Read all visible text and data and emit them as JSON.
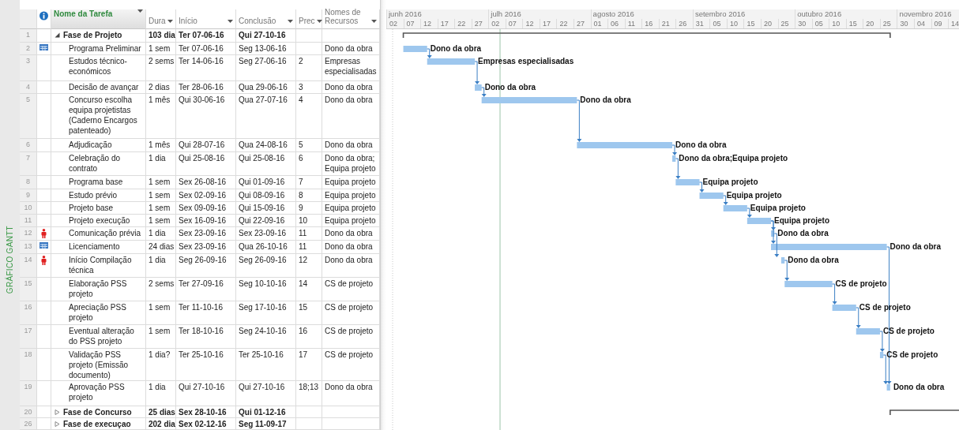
{
  "view_label": "GRÁFICO GANTT",
  "columns": [
    {
      "kind": "indicator",
      "selected": false
    },
    {
      "kind": "text",
      "label": "Nome da Tarefa",
      "selected": true
    },
    {
      "kind": "text",
      "label": "Dura",
      "selected": false
    },
    {
      "kind": "text",
      "label": "Início",
      "selected": false
    },
    {
      "kind": "text",
      "label": "Conclusão",
      "selected": false
    },
    {
      "kind": "text",
      "label": "Prec",
      "selected": false
    },
    {
      "kind": "text",
      "label": "Nomes de Recursos",
      "selected": false
    }
  ],
  "timeline": {
    "months": [
      {
        "label": "junh 2016",
        "days": [
          "02",
          "07",
          "12",
          "17",
          "22",
          "27"
        ]
      },
      {
        "label": "julh 2016",
        "days": [
          "02",
          "07",
          "12",
          "17",
          "22",
          "27"
        ]
      },
      {
        "label": "agosto 2016",
        "days": [
          "01",
          "06",
          "11",
          "16",
          "21",
          "26"
        ]
      },
      {
        "label": "setembro 2016",
        "days": [
          "31",
          "05",
          "10",
          "15",
          "20",
          "25"
        ]
      },
      {
        "label": "outubro 2016",
        "days": [
          "30",
          "05",
          "10",
          "15",
          "20",
          "25"
        ]
      },
      {
        "label": "novembro 2016",
        "days": [
          "30",
          "04",
          "09",
          "14"
        ]
      }
    ]
  },
  "tasks": [
    {
      "id": "1",
      "kind": "summary",
      "expanded": true,
      "name": "Fase de Projeto",
      "duration": "103 dia",
      "start": "Ter 07-06-16",
      "finish": "Qui 27-10-16",
      "children": [
        {
          "id": "2",
          "kind": "task",
          "indicator": {
            "kind": "calendar"
          },
          "name": "Programa Preliminar",
          "duration": "1 sem",
          "start": "Ter 07-06-16",
          "finish": "Seg 13-06-16",
          "resources": "Dono da obra",
          "bar_label": "Dono da obra"
        },
        {
          "id": "3",
          "kind": "task",
          "name": "Estudos técnico-económicos",
          "duration": "2 sems",
          "start": "Ter 14-06-16",
          "finish": "Seg 27-06-16",
          "predecessors": "2",
          "resources": "Empresas especialisadas",
          "bar_label": "Empresas especialisadas"
        },
        {
          "id": "4",
          "kind": "task",
          "name": "Decisão de avançar",
          "duration": "2 dias",
          "start": "Ter 28-06-16",
          "finish": "Qua 29-06-16",
          "predecessors": "3",
          "resources": "Dono da obra",
          "bar_label": "Dono da obra"
        },
        {
          "id": "5",
          "kind": "task",
          "name": "Concurso escolha equipa projetistas (Caderno Encargos patenteado)",
          "duration": "1 mês",
          "start": "Qui 30-06-16",
          "finish": "Qua 27-07-16",
          "predecessors": "4",
          "resources": "Dono da obra",
          "bar_label": "Dono da obra"
        },
        {
          "id": "6",
          "kind": "task",
          "name": "Adjudicação",
          "duration": "1 mês",
          "start": "Qui 28-07-16",
          "finish": "Qua 24-08-16",
          "predecessors": "5",
          "resources": "Dono da obra",
          "bar_label": "Dono da obra"
        },
        {
          "id": "7",
          "kind": "task",
          "name": "Celebração do contrato",
          "duration": "1 dia",
          "start": "Qui 25-08-16",
          "finish": "Qui 25-08-16",
          "predecessors": "6",
          "resources": "Dono da obra; Equipa projeto",
          "bar_label": "Dono da obra;Equipa projeto"
        },
        {
          "id": "8",
          "kind": "task",
          "name": "Programa base",
          "duration": "1 sem",
          "start": "Sex 26-08-16",
          "finish": "Qui 01-09-16",
          "predecessors": "7",
          "resources": "Equipa projeto",
          "bar_label": "Equipa projeto"
        },
        {
          "id": "9",
          "kind": "task",
          "name": "Estudo prévio",
          "duration": "1 sem",
          "start": "Sex 02-09-16",
          "finish": "Qui 08-09-16",
          "predecessors": "8",
          "resources": "Equipa projeto",
          "bar_label": "Equipa projeto"
        },
        {
          "id": "10",
          "kind": "task",
          "name": "Projeto base",
          "duration": "1 sem",
          "start": "Sex 09-09-16",
          "finish": "Qui 15-09-16",
          "predecessors": "9",
          "resources": "Equipa projeto",
          "bar_label": "Equipa projeto"
        },
        {
          "id": "11",
          "kind": "task",
          "name": "Projeto execução",
          "duration": "1 sem",
          "start": "Sex 16-09-16",
          "finish": "Qui 22-09-16",
          "predecessors": "10",
          "resources": "Equipa projeto",
          "bar_label": "Equipa projeto"
        },
        {
          "id": "12",
          "kind": "task",
          "indicator": {
            "kind": "person"
          },
          "name": "Comunicação prévia",
          "duration": "1 dia",
          "start": "Sex 23-09-16",
          "finish": "Sex 23-09-16",
          "predecessors": "11",
          "resources": "Dono da obra",
          "bar_label": "Dono da obra"
        },
        {
          "id": "13",
          "kind": "task",
          "indicator": {
            "kind": "calendar"
          },
          "name": "Licenciamento",
          "duration": "24 dias",
          "start": "Sex 23-09-16",
          "finish": "Qua 26-10-16",
          "predecessors": "11",
          "resources": "Dono da obra",
          "bar_label": "Dono da obra"
        },
        {
          "id": "14",
          "kind": "task",
          "indicator": {
            "kind": "person"
          },
          "name": "Início Compilação técnica",
          "duration": "1 dia",
          "start": "Seg 26-09-16",
          "finish": "Seg 26-09-16",
          "predecessors": "12",
          "resources": "Dono da obra",
          "bar_label": "Dono da obra"
        },
        {
          "id": "15",
          "kind": "task",
          "name": "Elaboração PSS projeto",
          "duration": "2 sems",
          "start": "Ter 27-09-16",
          "finish": "Seg 10-10-16",
          "predecessors": "14",
          "resources": "CS de projeto",
          "bar_label": "CS de projeto"
        },
        {
          "id": "16",
          "kind": "task",
          "name": "Apreciação PSS projeto",
          "duration": "1 sem",
          "start": "Ter 11-10-16",
          "finish": "Seg 17-10-16",
          "predecessors": "15",
          "resources": "CS de projeto",
          "bar_label": "CS de projeto"
        },
        {
          "id": "17",
          "kind": "task",
          "name": "Eventual alteração do PSS projeto",
          "duration": "1 sem",
          "start": "Ter 18-10-16",
          "finish": "Seg 24-10-16",
          "predecessors": "16",
          "resources": "CS de projeto",
          "bar_label": "CS de projeto"
        },
        {
          "id": "18",
          "kind": "task",
          "name": "Validação PSS projeto (Emissão documento)",
          "duration": "1 dia?",
          "start": "Ter 25-10-16",
          "finish": "Ter 25-10-16",
          "predecessors": "17",
          "resources": "CS de projeto",
          "bar_label": "CS de projeto"
        },
        {
          "id": "19",
          "kind": "task",
          "name": "Aprovação PSS projeto",
          "duration": "1 dia",
          "start": "Qui 27-10-16",
          "finish": "Qui 27-10-16",
          "predecessors": "18;13",
          "resources": "Dono da obra",
          "bar_label": "Dono da obra"
        }
      ]
    },
    {
      "id": "20",
      "kind": "summary",
      "expanded": false,
      "name": "Fase de Concurso",
      "duration": "25 dias",
      "start": "Sex 28-10-16",
      "finish": "Qui 01-12-16"
    },
    {
      "id": "26",
      "kind": "summary",
      "expanded": false,
      "name": "Fase de execuçao",
      "duration": "202 dia",
      "start": "Sex 02-12-16",
      "finish": "Seg 11-09-17"
    }
  ]
}
